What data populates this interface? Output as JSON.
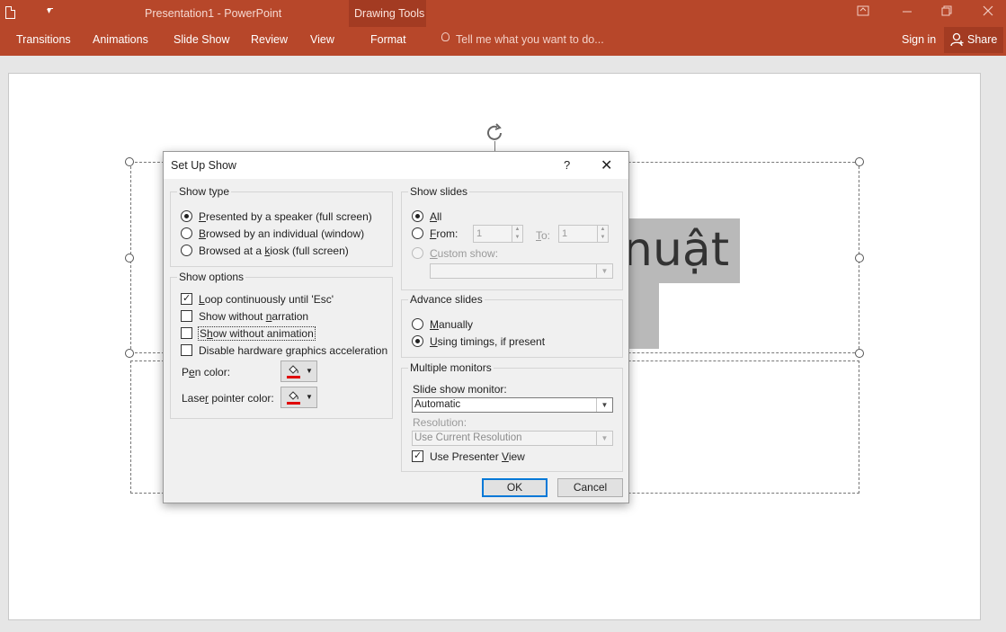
{
  "app": {
    "window_title": "Presentation1 - PowerPoint",
    "context_title": "Drawing Tools",
    "window_controls": [
      "restore-ribbon",
      "minimize",
      "maximize",
      "close"
    ]
  },
  "ribbon": {
    "tabs": [
      "Transitions",
      "Animations",
      "Slide Show",
      "Review",
      "View",
      "Format"
    ],
    "active_tab": "Format",
    "tell_me": "Tell me what you want to do...",
    "sign_in": "Sign in",
    "share": "Share"
  },
  "slide": {
    "visible_text_line1": "nuật"
  },
  "dialog": {
    "title": "Set Up Show",
    "help": "?",
    "close": "✕",
    "show_type": {
      "title": "Show type",
      "options": [
        {
          "label_u": "P",
          "label_rest": "resented by a speaker (full screen)",
          "selected": true
        },
        {
          "label_pre": "",
          "label_u": "B",
          "label_rest": "rowsed by an individual (window)",
          "selected": false
        },
        {
          "label_pre": "Browsed at a ",
          "label_u": "k",
          "label_rest": "iosk (full screen)",
          "selected": false
        }
      ]
    },
    "show_options": {
      "title": "Show options",
      "loop": {
        "pre": "",
        "u": "L",
        "rest": "oop continuously until 'Esc'",
        "checked": true
      },
      "narration": {
        "pre": "Show without ",
        "u": "n",
        "rest": "arration",
        "checked": false
      },
      "animation": {
        "pre": "S",
        "u": "h",
        "rest": "ow without animation",
        "checked": false
      },
      "hw_accel": {
        "pre": "Disable hardware ",
        "u": "g",
        "rest": "raphics acceleration",
        "checked": false
      },
      "pen_color": {
        "pre": "P",
        "u": "e",
        "rest": "n color:"
      },
      "laser_color": {
        "pre": "Lase",
        "u": "r",
        "rest": " pointer color:"
      },
      "pen_swatch": "#e00000",
      "laser_swatch": "#e00000"
    },
    "show_slides": {
      "title": "Show slides",
      "all": {
        "u": "A",
        "rest": "ll",
        "selected": true
      },
      "from": {
        "u": "F",
        "rest": "rom:",
        "selected": false,
        "value": "1"
      },
      "to": {
        "u": "T",
        "rest": "o:",
        "value": "1"
      },
      "custom": {
        "u": "C",
        "rest": "ustom show:",
        "selected": false,
        "value": ""
      }
    },
    "advance_slides": {
      "title": "Advance slides",
      "manually": {
        "u": "M",
        "rest": "anually",
        "selected": false
      },
      "timings": {
        "u": "U",
        "rest": "sing timings, if present",
        "selected": true
      }
    },
    "monitors": {
      "title": "Multiple monitors",
      "monitor_label": "Slide show monitor:",
      "monitor_value": "Automatic",
      "resolution_label": "Resolution:",
      "resolution_value": "Use Current Resolution",
      "presenter_view": {
        "pre": "Use Presenter ",
        "u": "V",
        "rest": "iew",
        "checked": true
      }
    },
    "ok": "OK",
    "cancel": "Cancel"
  },
  "colors": {
    "ribbon": "#b7472a",
    "context": "#a33b22",
    "dialog_bg": "#f0f0f0",
    "default_button_border": "#0078d7"
  }
}
